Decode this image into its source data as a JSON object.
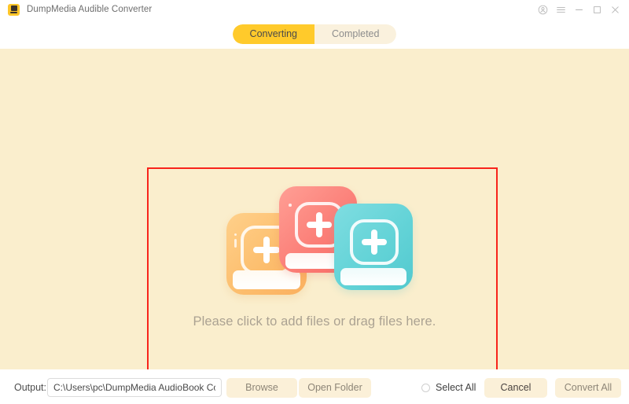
{
  "window": {
    "title": "DumpMedia Audible Converter",
    "app_icon": "audiobook-app-icon",
    "controls": [
      {
        "name": "account-icon",
        "glyph": "account"
      },
      {
        "name": "menu-icon",
        "glyph": "hamburger"
      },
      {
        "name": "minimize-icon",
        "glyph": "minimize"
      },
      {
        "name": "maximize-icon",
        "glyph": "maximize"
      },
      {
        "name": "close-icon",
        "glyph": "close"
      }
    ]
  },
  "tabs": [
    {
      "label": "Converting",
      "active": true
    },
    {
      "label": "Completed",
      "active": false
    }
  ],
  "dropzone": {
    "prompt": "Please click to add files or drag files here.",
    "highlight_color": "#f8241b",
    "illustration": {
      "icon_name": "add-files-books-illustration",
      "cards": [
        {
          "name": "book-card-orange",
          "color": "#fcbe6e",
          "badge": "plus-icon"
        },
        {
          "name": "book-card-pink",
          "color": "#fb7f78",
          "badge": "plus-icon"
        },
        {
          "name": "book-card-teal",
          "color": "#63d3d7",
          "badge": "plus-icon"
        }
      ]
    }
  },
  "footer": {
    "output_label": "Output:",
    "output_path": "C:\\Users\\pc\\DumpMedia AudioBook Converter",
    "output_placeholder": "C:\\Users\\pc\\DumpMedia AudioBook Converter",
    "browse_label": "Browse",
    "open_folder_label": "Open Folder",
    "select_all_label": "Select All",
    "select_all_checked": false,
    "cancel_label": "Cancel",
    "convert_all_label": "Convert All"
  },
  "theme": {
    "accent": "#ffca2b",
    "tab_inactive": "#faf1dd",
    "canvas": "#faeecd",
    "button_bg": "#fbf0d8",
    "prompt_text": "#aba292"
  }
}
